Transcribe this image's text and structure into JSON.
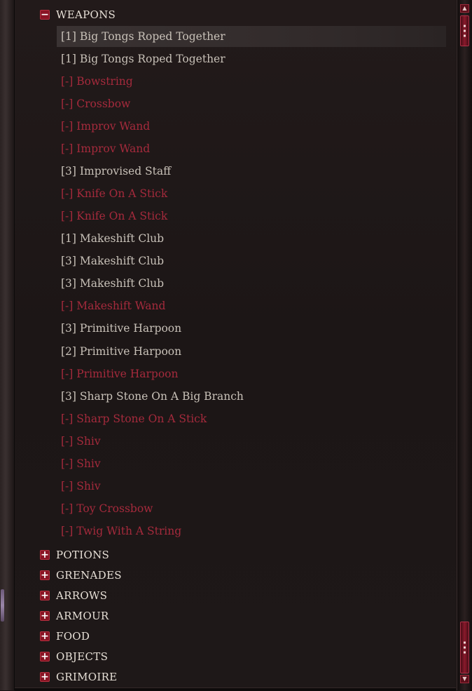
{
  "categories": [
    {
      "label": "WEAPONS",
      "expanded": true,
      "toggle": "−"
    },
    {
      "label": "POTIONS",
      "expanded": false,
      "toggle": "+"
    },
    {
      "label": "GRENADES",
      "expanded": false,
      "toggle": "+"
    },
    {
      "label": "ARROWS",
      "expanded": false,
      "toggle": "+"
    },
    {
      "label": "ARMOUR",
      "expanded": false,
      "toggle": "+"
    },
    {
      "label": "FOOD",
      "expanded": false,
      "toggle": "+"
    },
    {
      "label": "OBJECTS",
      "expanded": false,
      "toggle": "+"
    },
    {
      "label": "GRIMOIRE",
      "expanded": false,
      "toggle": "+"
    }
  ],
  "weapons_items": [
    {
      "label": "[1] Big Tongs Roped Together",
      "craftable": true,
      "selected": true
    },
    {
      "label": "[1] Big Tongs Roped Together",
      "craftable": true
    },
    {
      "label": "[-] Bowstring",
      "craftable": false
    },
    {
      "label": "[-] Crossbow",
      "craftable": false
    },
    {
      "label": "[-] Improv Wand",
      "craftable": false
    },
    {
      "label": "[-] Improv Wand",
      "craftable": false
    },
    {
      "label": "[3] Improvised Staff",
      "craftable": true
    },
    {
      "label": "[-] Knife On A Stick",
      "craftable": false
    },
    {
      "label": "[-] Knife On A Stick",
      "craftable": false
    },
    {
      "label": "[1] Makeshift Club",
      "craftable": true
    },
    {
      "label": "[3] Makeshift Club",
      "craftable": true
    },
    {
      "label": "[3] Makeshift Club",
      "craftable": true
    },
    {
      "label": "[-] Makeshift Wand",
      "craftable": false
    },
    {
      "label": "[3] Primitive Harpoon",
      "craftable": true
    },
    {
      "label": "[2] Primitive Harpoon",
      "craftable": true
    },
    {
      "label": "[-] Primitive Harpoon",
      "craftable": false
    },
    {
      "label": "[3] Sharp Stone On A Big Branch",
      "craftable": true
    },
    {
      "label": "[-] Sharp Stone On A Stick",
      "craftable": false
    },
    {
      "label": "[-] Shiv",
      "craftable": false
    },
    {
      "label": "[-] Shiv",
      "craftable": false
    },
    {
      "label": "[-] Shiv",
      "craftable": false
    },
    {
      "label": "[-] Toy Crossbow",
      "craftable": false
    },
    {
      "label": "[-] Twig With A String",
      "craftable": false
    }
  ],
  "colors": {
    "craftable_text": "#c8c1b8",
    "uncraftable_text": "#a52a3c",
    "accent": "#8a1424"
  },
  "scrollbar": {
    "up_icon": "arrow-up-icon",
    "down_icon": "arrow-down-icon"
  }
}
